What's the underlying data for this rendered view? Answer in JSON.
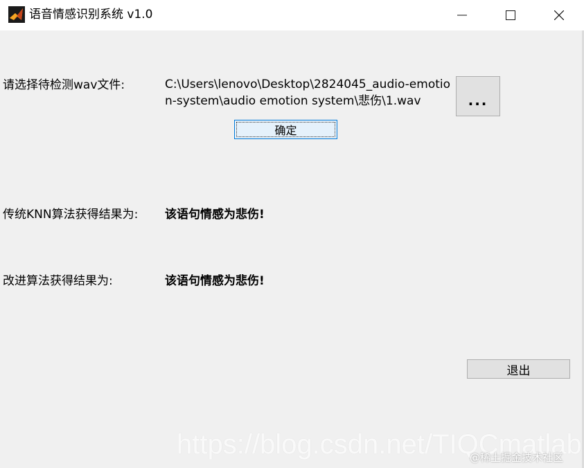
{
  "window": {
    "title": "语音情感识别系统 v1.0",
    "minimize_glyph": "—",
    "maximize_glyph": "☐",
    "close_glyph": "✕",
    "icon": "matlab-icon"
  },
  "form": {
    "select_label": "请选择待检测wav文件:",
    "file_path": "C:\\Users\\lenovo\\Desktop\\2824045_audio-emotion-system\\audio emotion system\\悲伤\\1.wav",
    "browse_label": "...",
    "confirm_label": "确定",
    "knn_label": "传统KNN算法获得结果为:",
    "knn_result": "该语句情感为悲伤!",
    "improved_label": "改进算法获得结果为:",
    "improved_result": "该语句情感为悲伤!",
    "exit_label": "退出"
  },
  "overlay": {
    "watermark": "https://blog.csdn.net/TIQCmatlab",
    "credit": "@稀土掘金技术社区"
  },
  "colors": {
    "background": "#f0f0f0",
    "focus_border": "#0078d7",
    "button_face": "#e1e1e1"
  }
}
